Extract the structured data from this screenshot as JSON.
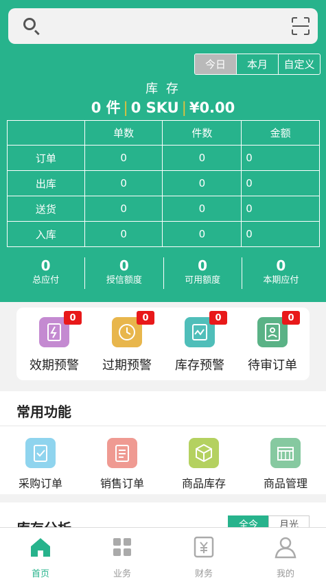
{
  "search": {
    "placeholder": ""
  },
  "period_tabs": [
    "今日",
    "本月",
    "自定义"
  ],
  "inventory": {
    "title": "库 存",
    "pieces": "0 件",
    "sku": "0 SKU",
    "amount": "¥0.00"
  },
  "table": {
    "headers": [
      "",
      "单数",
      "件数",
      "金额"
    ],
    "rows": [
      [
        "订单",
        "0",
        "0",
        "0"
      ],
      [
        "出库",
        "0",
        "0",
        "0"
      ],
      [
        "送货",
        "0",
        "0",
        "0"
      ],
      [
        "入库",
        "0",
        "0",
        "0"
      ]
    ]
  },
  "stats": [
    {
      "value": "0",
      "label": "总应付"
    },
    {
      "value": "0",
      "label": "授信额度"
    },
    {
      "value": "0",
      "label": "可用额度"
    },
    {
      "value": "0",
      "label": "本期应付"
    }
  ],
  "alerts": [
    {
      "label": "效期预警",
      "count": "0",
      "icon": "expiry-warning-icon",
      "color": "#c48ad1"
    },
    {
      "label": "过期预警",
      "count": "0",
      "icon": "overdue-warning-icon",
      "color": "#e8b64c"
    },
    {
      "label": "库存预警",
      "count": "0",
      "icon": "stock-warning-icon",
      "color": "#4fbeb9"
    },
    {
      "label": "待审订单",
      "count": "0",
      "icon": "pending-order-icon",
      "color": "#5ab286"
    }
  ],
  "common_functions": {
    "title": "常用功能",
    "items": [
      {
        "label": "采购订单",
        "icon": "purchase-order-icon",
        "color": "#8fd4ee"
      },
      {
        "label": "销售订单",
        "icon": "sales-order-icon",
        "color": "#ef9a92"
      },
      {
        "label": "商品库存",
        "icon": "product-stock-icon",
        "color": "#b4d160"
      },
      {
        "label": "商品管理",
        "icon": "product-manage-icon",
        "color": "#86c9a0"
      }
    ]
  },
  "inventory_analysis": {
    "title": "库存分析",
    "tabs": [
      "全今",
      "月光"
    ]
  },
  "tabbar": [
    {
      "label": "首页",
      "icon": "home-icon",
      "active": true
    },
    {
      "label": "业务",
      "icon": "business-icon",
      "active": false
    },
    {
      "label": "财务",
      "icon": "finance-icon",
      "active": false
    },
    {
      "label": "我的",
      "icon": "profile-icon",
      "active": false
    }
  ],
  "colors": {
    "primary": "#27b38c",
    "badge": "#e8191a",
    "accent": "#e7c23a"
  }
}
